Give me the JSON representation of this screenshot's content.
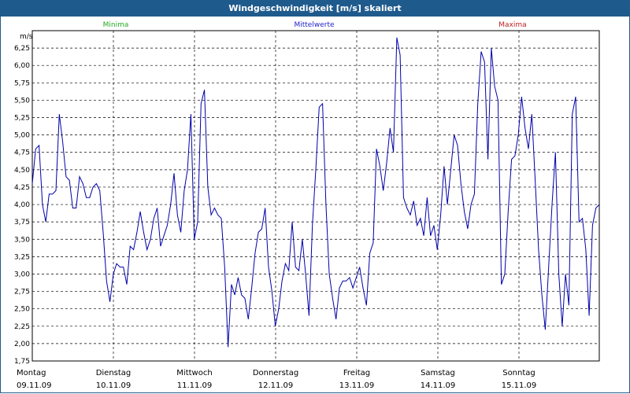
{
  "window": {
    "title": "Windgeschwindigkeit [m/s] skaliert"
  },
  "legend": [
    {
      "label": "Minima",
      "color": "#22aa22"
    },
    {
      "label": "Mittelwerte",
      "color": "#2222cc"
    },
    {
      "label": "Maxima",
      "color": "#bb2222"
    }
  ],
  "chart_data": {
    "type": "line",
    "ylabel": "m/s",
    "ylim": [
      1.75,
      6.5
    ],
    "yticks": [
      "1,75",
      "2,00",
      "2,25",
      "2,50",
      "2,75",
      "3,00",
      "3,25",
      "3,50",
      "3,75",
      "4,00",
      "4,25",
      "4,50",
      "4,75",
      "5,00",
      "5,25",
      "5,50",
      "5,75",
      "6,00",
      "6,25"
    ],
    "x_categories": [
      {
        "day": "Montag",
        "date": "09.11.09"
      },
      {
        "day": "Dienstag",
        "date": "10.11.09"
      },
      {
        "day": "Mittwoch",
        "date": "11.11.09"
      },
      {
        "day": "Donnerstag",
        "date": "12.11.09"
      },
      {
        "day": "Freitag",
        "date": "13.11.09"
      },
      {
        "day": "Samstag",
        "date": "14.11.09"
      },
      {
        "day": "Sonntag",
        "date": "15.11.09"
      }
    ],
    "grid": true,
    "series": [
      {
        "name": "Mittelwerte",
        "color": "#0000aa",
        "values": [
          4.3,
          4.8,
          4.85,
          4.0,
          3.75,
          4.15,
          4.15,
          4.2,
          5.3,
          4.9,
          4.4,
          4.35,
          3.95,
          3.95,
          4.4,
          4.3,
          4.1,
          4.1,
          4.25,
          4.3,
          4.2,
          3.6,
          2.9,
          2.6,
          3.0,
          3.15,
          3.1,
          3.1,
          2.85,
          3.4,
          3.35,
          3.6,
          3.9,
          3.6,
          3.35,
          3.5,
          3.8,
          3.95,
          3.4,
          3.55,
          3.7,
          4.0,
          4.45,
          3.85,
          3.6,
          4.2,
          4.5,
          5.3,
          3.5,
          3.75,
          5.45,
          5.65,
          4.25,
          3.85,
          3.95,
          3.85,
          3.8,
          3.1,
          1.95,
          2.85,
          2.7,
          2.95,
          2.7,
          2.65,
          2.35,
          2.8,
          3.3,
          3.6,
          3.65,
          3.95,
          3.1,
          2.75,
          2.25,
          2.5,
          2.9,
          3.15,
          3.05,
          3.75,
          3.1,
          3.05,
          3.5,
          3.0,
          2.4,
          3.7,
          4.5,
          5.4,
          5.45,
          4.0,
          3.0,
          2.65,
          2.35,
          2.8,
          2.9,
          2.9,
          2.95,
          2.8,
          2.95,
          3.1,
          2.8,
          2.55,
          3.3,
          3.45,
          4.8,
          4.55,
          4.2,
          4.6,
          5.1,
          4.75,
          6.4,
          6.15,
          4.1,
          3.95,
          3.85,
          4.05,
          3.7,
          3.8,
          3.55,
          4.1,
          3.55,
          3.7,
          3.35,
          3.85,
          4.55,
          4.0,
          4.5,
          5.0,
          4.85,
          4.3,
          3.9,
          3.65,
          4.0,
          4.15,
          5.45,
          6.2,
          6.05,
          4.65,
          6.25,
          5.7,
          5.5,
          2.85,
          3.0,
          3.9,
          4.65,
          4.7,
          5.0,
          5.55,
          5.1,
          4.8,
          5.3,
          4.35,
          3.35,
          2.7,
          2.2,
          3.1,
          4.0,
          4.75,
          3.0,
          2.25,
          3.0,
          2.55,
          5.3,
          5.55,
          3.75,
          3.8,
          3.35,
          2.4,
          3.7,
          3.95,
          4.0
        ]
      }
    ]
  }
}
